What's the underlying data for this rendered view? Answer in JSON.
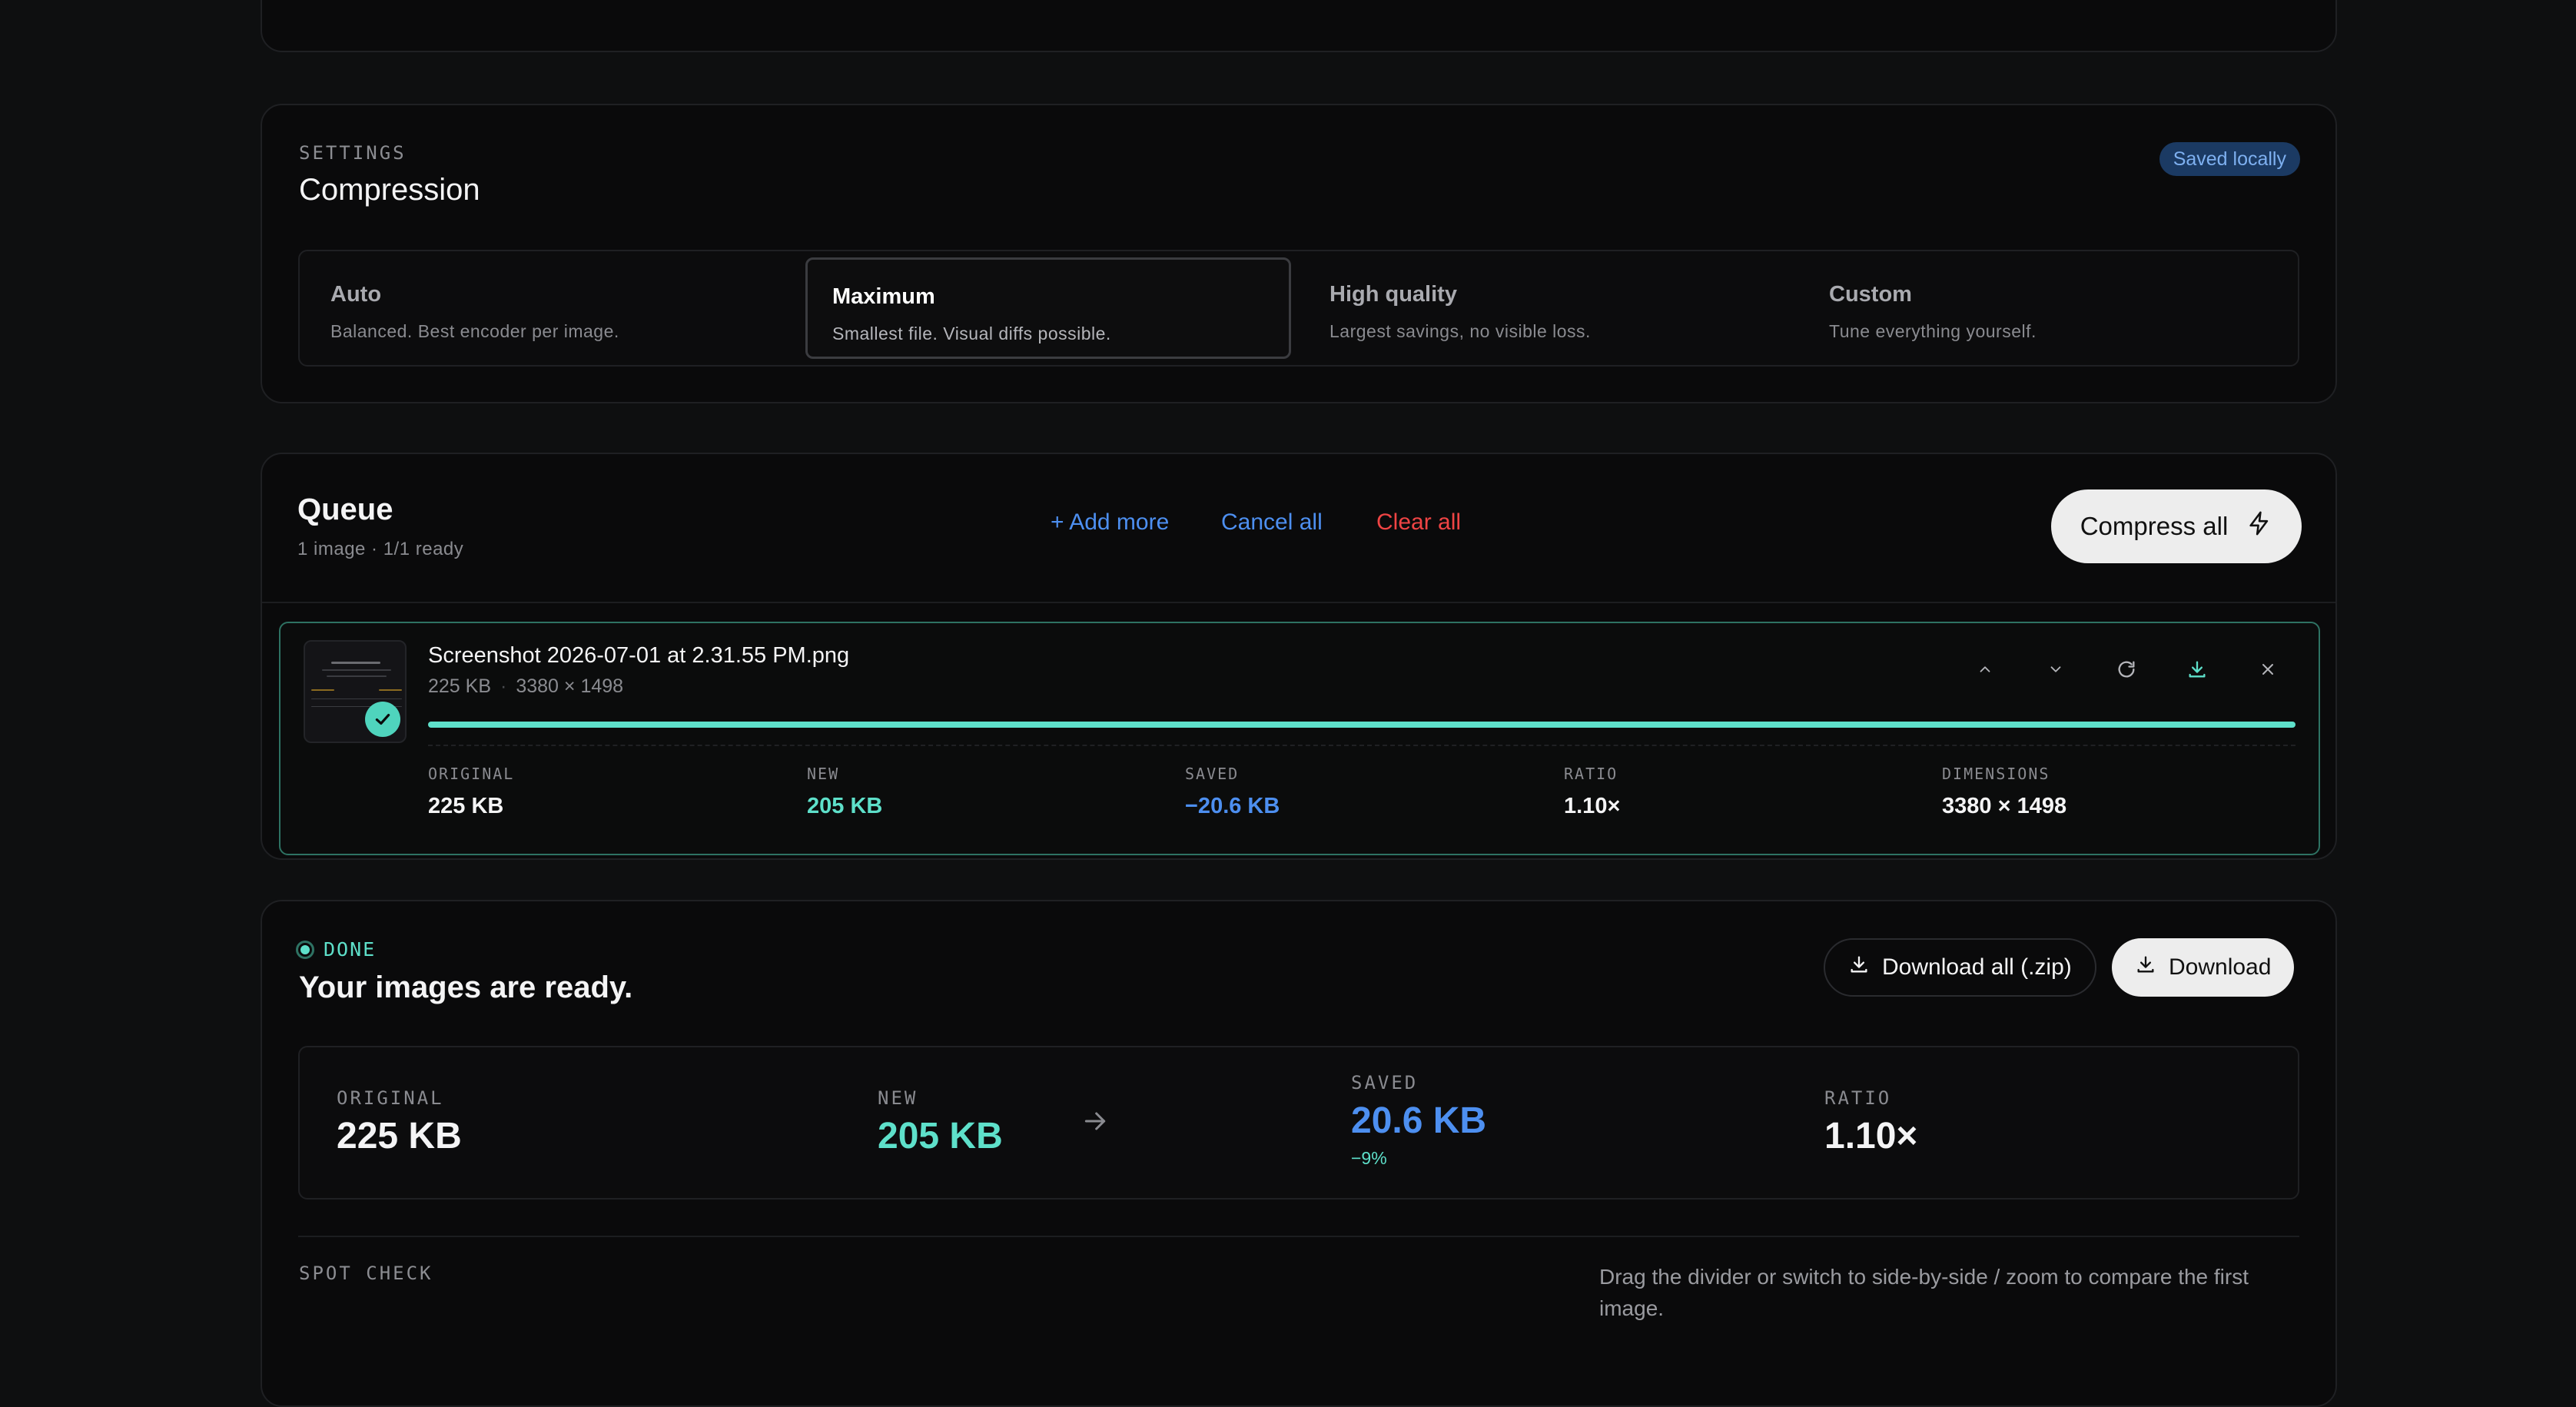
{
  "settings": {
    "overline": "SETTINGS",
    "title": "Compression",
    "badge": "Saved locally",
    "modes": [
      {
        "title": "Auto",
        "desc": "Balanced. Best encoder per image."
      },
      {
        "title": "Maximum",
        "desc": "Smallest file. Visual diffs possible."
      },
      {
        "title": "High quality",
        "desc": "Largest savings, no visible loss."
      },
      {
        "title": "Custom",
        "desc": "Tune everything yourself."
      }
    ],
    "selected": "Maximum"
  },
  "queue": {
    "title": "Queue",
    "subtitle": "1 image · 1/1 ready",
    "add_more": "+ Add more",
    "cancel_all": "Cancel all",
    "clear_all": "Clear all",
    "compress_all": "Compress all",
    "file": {
      "name": "Screenshot 2026-07-01 at 2.31.55 PM.png",
      "size": "225 KB",
      "dimensions": "3380 × 1498",
      "progress": 1.0,
      "stats": [
        {
          "label": "ORIGINAL",
          "value": "225 KB"
        },
        {
          "label": "NEW",
          "value": "205 KB"
        },
        {
          "label": "SAVED",
          "value": "−20.6 KB"
        },
        {
          "label": "RATIO",
          "value": "1.10×"
        },
        {
          "label": "DIMENSIONS",
          "value": "3380 × 1498"
        }
      ]
    },
    "colors": {
      "accent": "#5ee0ca",
      "blue": "#4d8ff0",
      "red": "#ef4444",
      "row_border": "#2e7263"
    }
  },
  "done": {
    "status": "DONE",
    "title": "Your images are ready.",
    "download_zip": "Download all (.zip)",
    "download": "Download",
    "summary": {
      "original_label": "ORIGINAL",
      "original_value": "225 KB",
      "new_label": "NEW",
      "new_value": "205 KB",
      "saved_label": "SAVED",
      "saved_value": "20.6 KB",
      "saved_pct": "−9%",
      "ratio_label": "RATIO",
      "ratio_value": "1.10×"
    },
    "spot_check_label": "SPOT CHECK",
    "spot_check_hint": "Drag the divider or switch to side-by-side / zoom to compare the first image."
  }
}
